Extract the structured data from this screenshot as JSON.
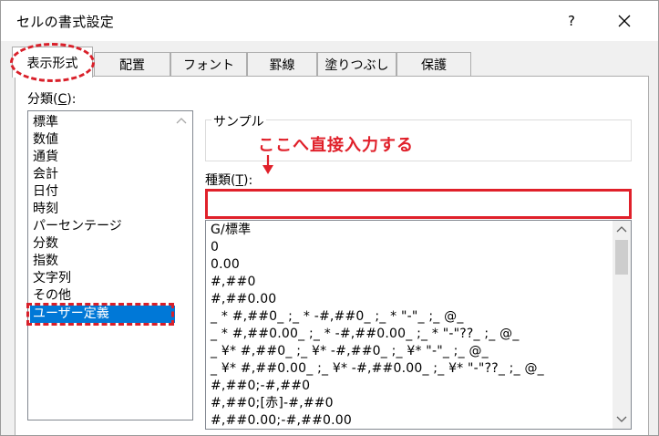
{
  "dialog": {
    "title": "セルの書式設定",
    "help": "?",
    "close_icon": "close-icon"
  },
  "tabs": [
    {
      "label": "表示形式",
      "active": true
    },
    {
      "label": "配置"
    },
    {
      "label": "フォント"
    },
    {
      "label": "罫線"
    },
    {
      "label": "塗りつぶし"
    },
    {
      "label": "保護"
    }
  ],
  "category": {
    "label_prefix": "分類(",
    "label_key": "C",
    "label_suffix": "):",
    "items": [
      "標準",
      "数値",
      "通貨",
      "会計",
      "日付",
      "時刻",
      "パーセンテージ",
      "分数",
      "指数",
      "文字列",
      "その他",
      "ユーザー定義"
    ],
    "selected": "ユーザー定義"
  },
  "sample": {
    "label": "サンプル",
    "value": ""
  },
  "annotation": {
    "text": "ここへ直接入力する",
    "color": "#e0202a"
  },
  "type": {
    "label_prefix": "種類(",
    "label_key": "T",
    "label_suffix": "):",
    "value": "",
    "formats": [
      "G/標準",
      "0",
      "0.00",
      "#,##0",
      "#,##0.00",
      "_ * #,##0_ ;_ * -#,##0_ ;_ * \"-\"_ ;_ @_",
      "_ * #,##0.00_ ;_ * -#,##0.00_ ;_ * \"-\"??_ ;_ @_",
      "_ ¥* #,##0_ ;_ ¥* -#,##0_ ;_ ¥* \"-\"_ ;_ @_",
      "_ ¥* #,##0.00_ ;_ ¥* -#,##0.00_ ;_ ¥* \"-\"??_ ;_ @_",
      "#,##0;-#,##0",
      "#,##0;[赤]-#,##0",
      "#,##0.00;-#,##0.00"
    ]
  },
  "colors": {
    "accent": "#0078d7",
    "highlight_red": "#d9202a"
  }
}
